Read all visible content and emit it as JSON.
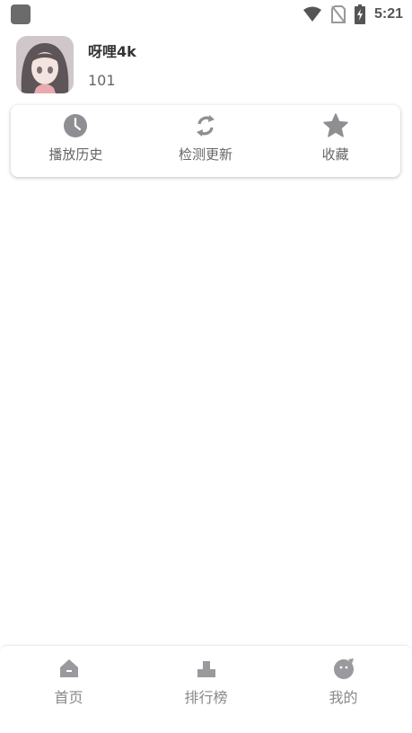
{
  "status_bar": {
    "time": "5:21",
    "icons": [
      "app-icon",
      "wifi-icon",
      "no-sim-icon",
      "battery-charging-icon"
    ]
  },
  "profile": {
    "name": "呀哩4k",
    "id": "101",
    "avatar": "anime-girl-avatar"
  },
  "actions": [
    {
      "label": "播放历史",
      "icon": "clock-icon"
    },
    {
      "label": "检测更新",
      "icon": "refresh-icon"
    },
    {
      "label": "收藏",
      "icon": "star-icon"
    }
  ],
  "bottom_nav": [
    {
      "label": "首页",
      "icon": "home-icon"
    },
    {
      "label": "排行榜",
      "icon": "ranking-icon"
    },
    {
      "label": "我的",
      "icon": "profile-face-icon"
    }
  ],
  "colors": {
    "icon": "#8e8e93",
    "text_primary": "#333333",
    "text_secondary": "#666666",
    "nav_text": "#888888"
  }
}
